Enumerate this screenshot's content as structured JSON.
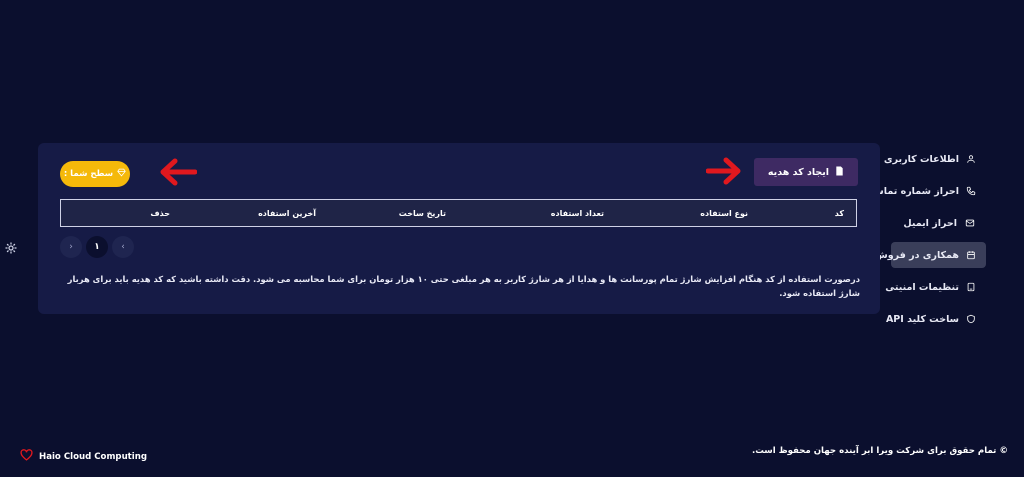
{
  "sidebar": {
    "items": [
      {
        "label": "اطلاعات کاربری",
        "icon": "user-icon"
      },
      {
        "label": "احراز شماره تماس",
        "icon": "phone-icon"
      },
      {
        "label": "احراز ایمیل",
        "icon": "mail-icon"
      },
      {
        "label": "همکاری در فروش",
        "icon": "calendar-icon"
      },
      {
        "label": "تنظیمات امنیتی",
        "icon": "tablet-icon"
      },
      {
        "label": "ساخت کلید API",
        "icon": "shield-icon"
      }
    ],
    "active_label": "همکاری در فروش"
  },
  "main": {
    "create_gift_label": "ایجاد کد هدیه",
    "level_label": "سطح شما :",
    "table": {
      "columns": [
        "کد",
        "نوع استفاده",
        "تعداد استفاده",
        "تاریخ ساخت",
        "آخرین استفاده",
        "حذف"
      ]
    },
    "pagination": {
      "prev": "‹",
      "current": "۱",
      "next": "›"
    },
    "note": "درصورت استفاده از کد هنگام افزایش شارژ تمام پورسانت ها و هدایا از هر شارژ کاربر به هر مبلغی حتی ۱۰ هزار تومان برای شما محاسبه می شود. دقت داشته باشید که کد هدیه باید برای هربار شارژ استفاده شود."
  },
  "footer": {
    "copyright": "© تمام حقوق برای شرکت ویرا ابر آینده جهان محفوظ است.",
    "brand": "Haio Cloud Computing"
  },
  "colors": {
    "background": "#0b0f2e",
    "card": "#161b46",
    "gift_button": "#3e2a63",
    "level_button": "#f5b90a",
    "annotation_arrow": "#e0181e",
    "heart": "#e0181e"
  }
}
